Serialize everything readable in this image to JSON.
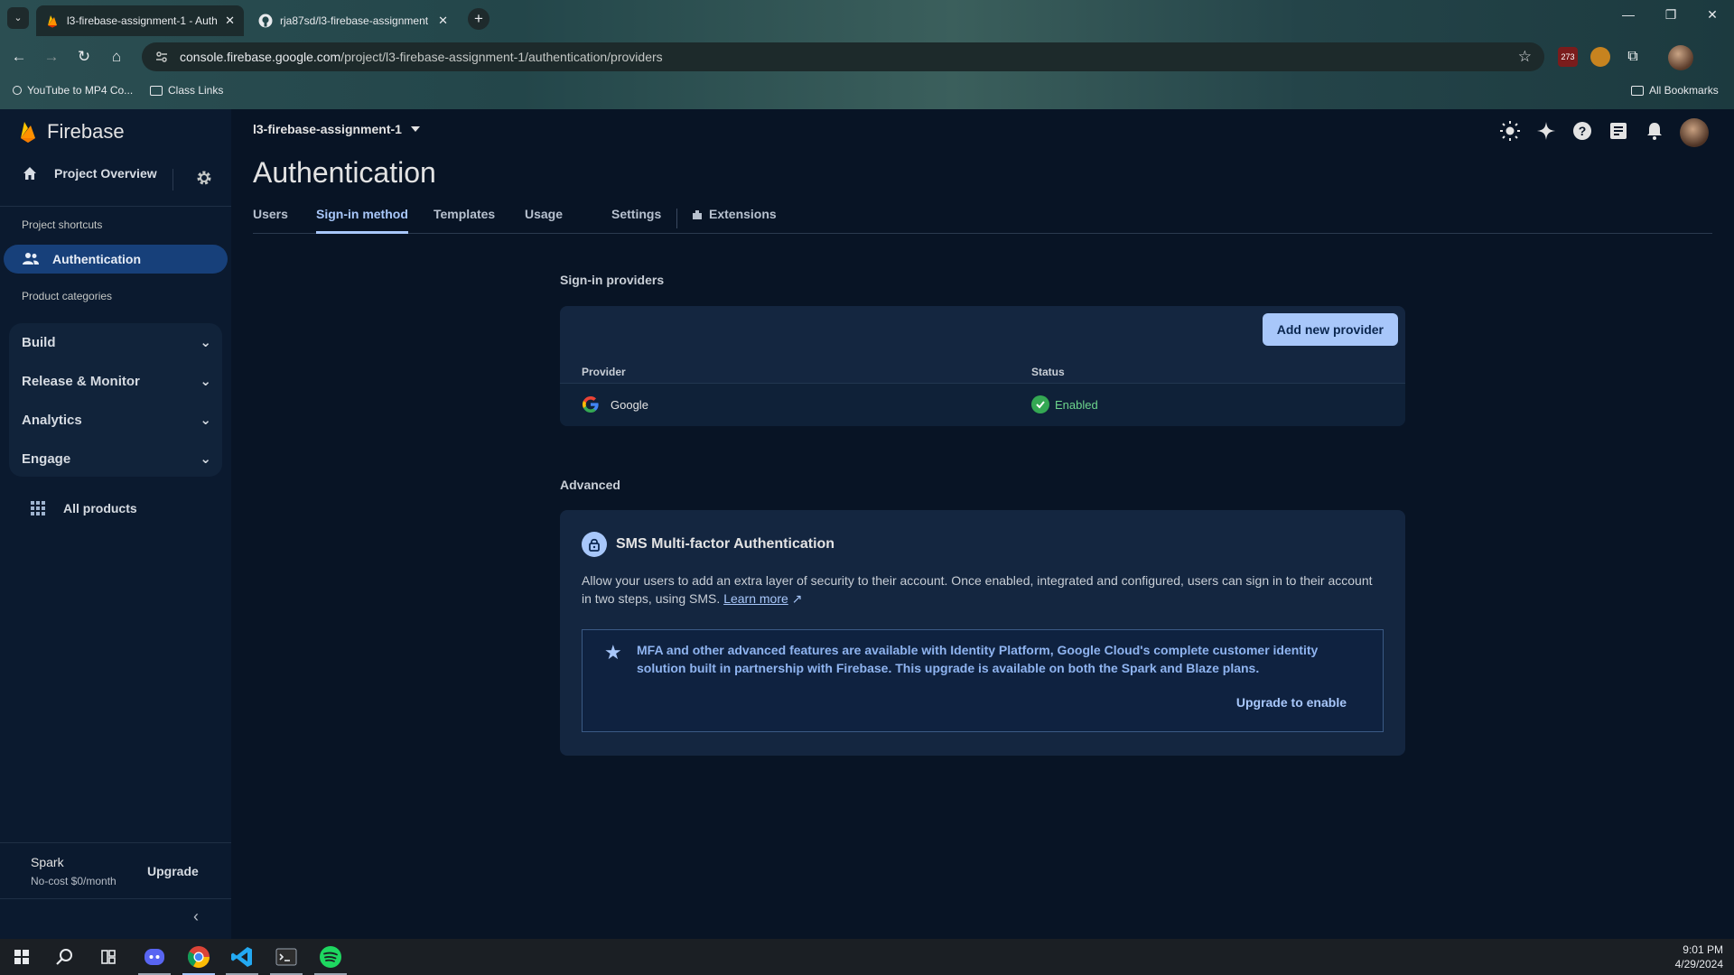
{
  "browser": {
    "tabs": [
      {
        "title": "l3-firebase-assignment-1 - Auth",
        "active": true
      },
      {
        "title": "rja87sd/l3-firebase-assignment",
        "active": false
      }
    ],
    "url_host": "console.firebase.google.com",
    "url_path": "/project/l3-firebase-assignment-1/authentication/providers",
    "bookmarks": [
      "YouTube to MP4 Co...",
      "Class Links"
    ],
    "all_bookmarks": "All Bookmarks",
    "ext_badge": "273"
  },
  "sidebar": {
    "brand": "Firebase",
    "project_overview": "Project Overview",
    "shortcuts_label": "Project shortcuts",
    "active_item": "Authentication",
    "categories_label": "Product categories",
    "categories": [
      "Build",
      "Release & Monitor",
      "Analytics",
      "Engage"
    ],
    "all_products": "All products",
    "plan_name": "Spark",
    "plan_desc": "No-cost $0/month",
    "upgrade": "Upgrade"
  },
  "header": {
    "project": "l3-firebase-assignment-1",
    "title": "Authentication",
    "tabs": [
      "Users",
      "Sign-in method",
      "Templates",
      "Usage",
      "Settings",
      "Extensions"
    ]
  },
  "providers": {
    "section_label": "Sign-in providers",
    "add_button": "Add new provider",
    "col_provider": "Provider",
    "col_status": "Status",
    "rows": [
      {
        "name": "Google",
        "status": "Enabled"
      }
    ]
  },
  "advanced": {
    "section_label": "Advanced",
    "mfa_title": "SMS Multi-factor Authentication",
    "mfa_desc": "Allow your users to add an extra layer of security to their account. Once enabled, integrated and configured, users can sign in to their account in two steps, using SMS.",
    "learn_more": "Learn more",
    "notice": "MFA and other advanced features are available with Identity Platform, Google Cloud's complete customer identity solution built in partnership with Firebase. This upgrade is available on both the Spark and Blaze plans.",
    "upgrade_link": "Upgrade to enable"
  },
  "taskbar": {
    "time": "9:01 PM",
    "date": "4/29/2024"
  },
  "colors": {
    "accent": "#a8c7fa",
    "sidebar_active": "#17407a",
    "enabled": "#34a853",
    "background": "#081425"
  }
}
